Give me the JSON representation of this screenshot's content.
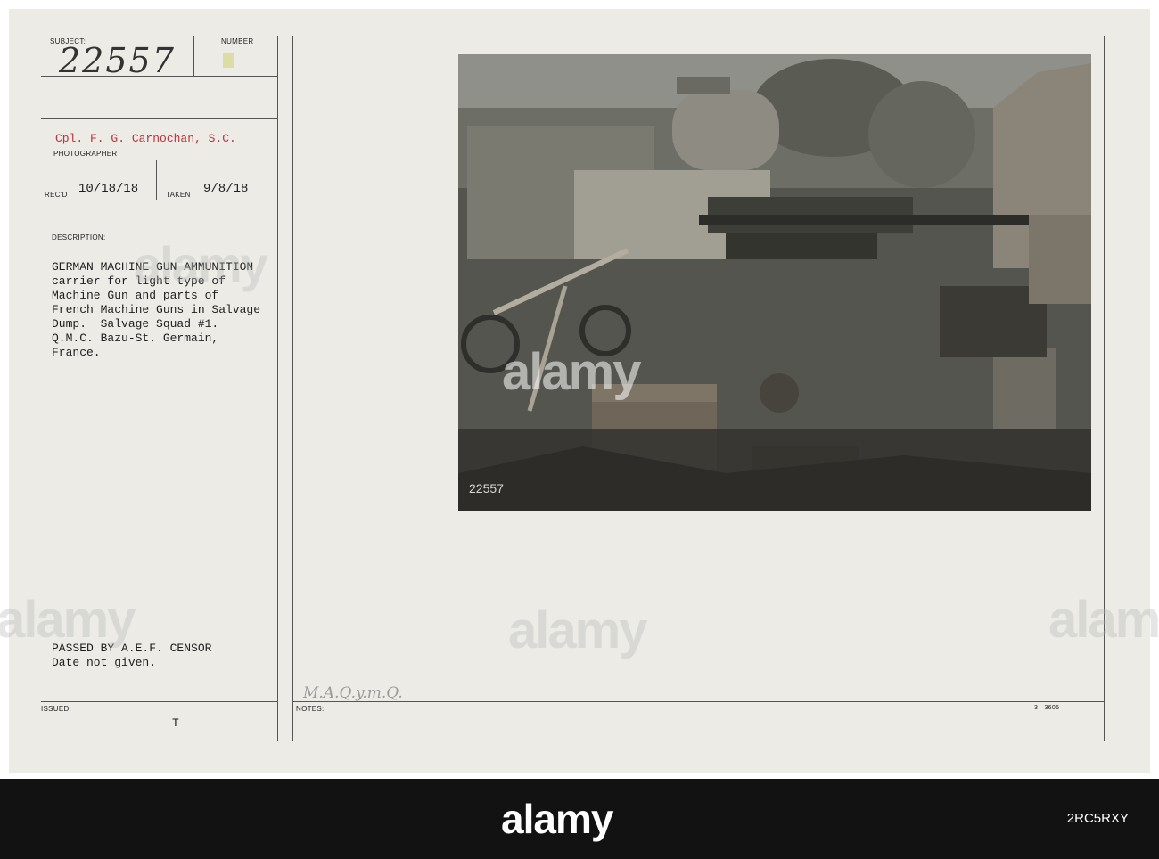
{
  "card": {
    "labels": {
      "subject": "SUBJECT:",
      "number": "NUMBER",
      "photographer": "PHOTOGRAPHER",
      "recd": "REC'D",
      "taken": "TAKEN",
      "description": "DESCRIPTION:",
      "issued": "ISSUED:",
      "notes": "NOTES:"
    },
    "subject_handwritten": "22557",
    "photographer_name": "Cpl. F. G. Carnochan, S.C.",
    "recd_date": "10/18/18",
    "taken_date": "9/8/18",
    "description_lines": [
      "GERMAN MACHINE GUN AMMUNITION",
      "carrier for light type of",
      "Machine Gun and parts of",
      "French Machine Guns in Salvage",
      "Dump.  Salvage Squad #1.",
      "Q.M.C. Bazu-St. Germain,",
      "France."
    ],
    "censor_lines": [
      "PASSED BY A.E.F. CENSOR",
      "Date not given."
    ],
    "issued_mark": "T",
    "notes_handwritten": "M.A.Q.y.m.Q.",
    "form_number": "3—3605",
    "photo_stamp_number": "22557"
  },
  "watermark": {
    "text": "alamy"
  },
  "footer": {
    "logo": "alamy",
    "image_id": "2RC5RXY",
    "background": "#121212"
  }
}
